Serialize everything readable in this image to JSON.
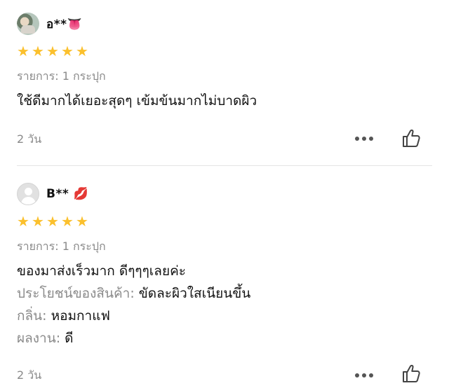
{
  "reviews": [
    {
      "username": "อ**👅",
      "avatar": "user-photo",
      "rating": 5,
      "variant": "รายการ: 1 กระปุก",
      "content_lines": [
        {
          "key": "",
          "value": "ใช้ดีมากได้เยอะสุดๆ เข้มข้นมากไม่บาดผิว"
        }
      ],
      "date": "2 วัน"
    },
    {
      "username": "B** 💋",
      "avatar": "default-avatar",
      "rating": 5,
      "variant": "รายการ: 1 กระปุก",
      "content_lines": [
        {
          "key": "",
          "value": "ของมาส่งเร็วมาก ดีๆๆๆเลยค่ะ"
        },
        {
          "key": "ประโยชน์ของสินค้า: ",
          "value": "ขัดละผิวใสเนียนขึ้น"
        },
        {
          "key": "กลิ่น: ",
          "value": "หอมกาแฟ"
        },
        {
          "key": "ผลงาน: ",
          "value": "ดี"
        }
      ],
      "date": "2 วัน"
    }
  ],
  "colors": {
    "star": "#fbc02d",
    "muted_text": "#8a8a8a",
    "divider": "#e4e4e4"
  }
}
